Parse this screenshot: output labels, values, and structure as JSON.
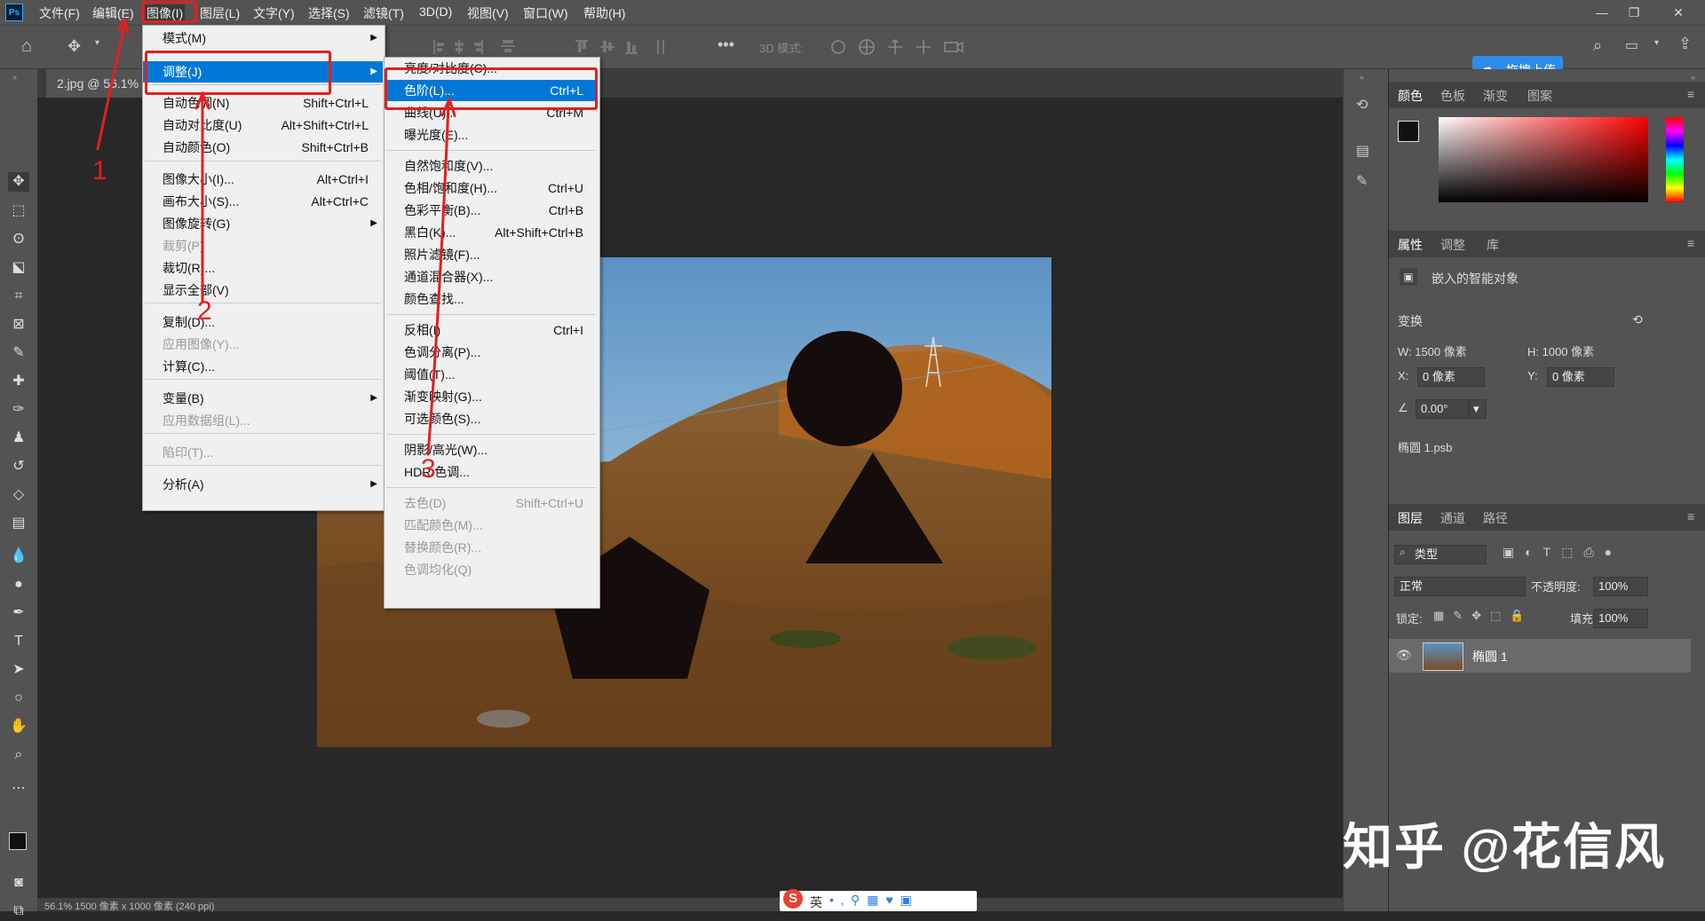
{
  "app": {
    "logo": "Ps"
  },
  "menubar": {
    "items": [
      "文件(F)",
      "编辑(E)",
      "图像(I)",
      "图层(L)",
      "文字(Y)",
      "选择(S)",
      "滤镜(T)",
      "3D(D)",
      "视图(V)",
      "窗口(W)",
      "帮助(H)"
    ],
    "window_buttons": [
      "—",
      "❐",
      "✕"
    ]
  },
  "optbar": {
    "label_3d": "3D 模式:",
    "cloud_button": "拖拽上传"
  },
  "document": {
    "tab_title": "2.jpg @ 56.1%",
    "status": "56.1%  1500 像素 x 1000 像素 (240 ppi)"
  },
  "image_menu": {
    "items": [
      {
        "label": "模式(M)",
        "shortcut": "",
        "submenu": true,
        "disabled": false
      },
      {
        "label": "调整(J)",
        "shortcut": "",
        "submenu": true,
        "disabled": false,
        "highlight": true
      },
      {
        "label": "自动色调(N)",
        "shortcut": "Shift+Ctrl+L",
        "disabled": false
      },
      {
        "label": "自动对比度(U)",
        "shortcut": "Alt+Shift+Ctrl+L",
        "disabled": false
      },
      {
        "label": "自动颜色(O)",
        "shortcut": "Shift+Ctrl+B",
        "disabled": false
      },
      {
        "label": "图像大小(I)...",
        "shortcut": "Alt+Ctrl+I",
        "disabled": false
      },
      {
        "label": "画布大小(S)...",
        "shortcut": "Alt+Ctrl+C",
        "disabled": false
      },
      {
        "label": "图像旋转(G)",
        "shortcut": "",
        "submenu": true,
        "disabled": false
      },
      {
        "label": "裁剪(P)",
        "shortcut": "",
        "disabled": true
      },
      {
        "label": "裁切(R)...",
        "shortcut": "",
        "disabled": false
      },
      {
        "label": "显示全部(V)",
        "shortcut": "",
        "disabled": false
      },
      {
        "label": "复制(D)...",
        "shortcut": "",
        "disabled": false
      },
      {
        "label": "应用图像(Y)...",
        "shortcut": "",
        "disabled": true
      },
      {
        "label": "计算(C)...",
        "shortcut": "",
        "disabled": false
      },
      {
        "label": "变量(B)",
        "shortcut": "",
        "submenu": true,
        "disabled": false
      },
      {
        "label": "应用数据组(L)...",
        "shortcut": "",
        "disabled": true
      },
      {
        "label": "陷印(T)...",
        "shortcut": "",
        "disabled": true
      },
      {
        "label": "分析(A)",
        "shortcut": "",
        "submenu": true,
        "disabled": false
      }
    ]
  },
  "adjust_menu": {
    "items": [
      {
        "label": "亮度/对比度(C)...",
        "shortcut": "",
        "disabled": false
      },
      {
        "label": "色阶(L)...",
        "shortcut": "Ctrl+L",
        "disabled": false,
        "highlight": true
      },
      {
        "label": "曲线(U)...",
        "shortcut": "Ctrl+M",
        "disabled": false
      },
      {
        "label": "曝光度(E)...",
        "shortcut": "",
        "disabled": false
      },
      {
        "label": "自然饱和度(V)...",
        "shortcut": "",
        "disabled": false
      },
      {
        "label": "色相/饱和度(H)...",
        "shortcut": "Ctrl+U",
        "disabled": false
      },
      {
        "label": "色彩平衡(B)...",
        "shortcut": "Ctrl+B",
        "disabled": false
      },
      {
        "label": "黑白(K)...",
        "shortcut": "Alt+Shift+Ctrl+B",
        "disabled": false
      },
      {
        "label": "照片滤镜(F)...",
        "shortcut": "",
        "disabled": false
      },
      {
        "label": "通道混合器(X)...",
        "shortcut": "",
        "disabled": false
      },
      {
        "label": "颜色查找...",
        "shortcut": "",
        "disabled": false
      },
      {
        "label": "反相(I)",
        "shortcut": "Ctrl+I",
        "disabled": false
      },
      {
        "label": "色调分离(P)...",
        "shortcut": "",
        "disabled": false
      },
      {
        "label": "阈值(T)...",
        "shortcut": "",
        "disabled": false
      },
      {
        "label": "渐变映射(G)...",
        "shortcut": "",
        "disabled": false
      },
      {
        "label": "可选颜色(S)...",
        "shortcut": "",
        "disabled": false
      },
      {
        "label": "阴影/高光(W)...",
        "shortcut": "",
        "disabled": false
      },
      {
        "label": "HDR 色调...",
        "shortcut": "",
        "disabled": false
      },
      {
        "label": "去色(D)",
        "shortcut": "Shift+Ctrl+U",
        "disabled": true
      },
      {
        "label": "匹配颜色(M)...",
        "shortcut": "",
        "disabled": true
      },
      {
        "label": "替换颜色(R)...",
        "shortcut": "",
        "disabled": true
      },
      {
        "label": "色调均化(Q)",
        "shortcut": "",
        "disabled": true
      }
    ]
  },
  "color_panel": {
    "tabs": [
      "颜色",
      "色板",
      "渐变",
      "图案"
    ]
  },
  "properties_panel": {
    "tabs": [
      "属性",
      "调整",
      "库"
    ],
    "object_type": "嵌入的智能对象",
    "transform_label": "变换",
    "w": "W:  1500 像素",
    "h": "H:  1000 像素",
    "x_label": "X:",
    "x_value": "0 像素",
    "y_label": "Y:",
    "y_value": "0 像素",
    "angle": "0.00°",
    "file": "椭圆 1.psb"
  },
  "layers_panel": {
    "tabs": [
      "图层",
      "通道",
      "路径"
    ],
    "filter": "类型",
    "blend": "正常",
    "opacity_label": "不透明度:",
    "opacity": "100%",
    "lock_label": "锁定:",
    "fill_label": "填充:",
    "fill": "100%",
    "layer_name": "椭圆 1"
  },
  "watermark": "知乎 @花信风",
  "annotations": [
    "1",
    "2",
    "3"
  ],
  "ime": {
    "label": "英"
  },
  "colors": {
    "highlight": "#0078d7",
    "annotation": "#e02020",
    "cloud": "#2d8ceb"
  }
}
